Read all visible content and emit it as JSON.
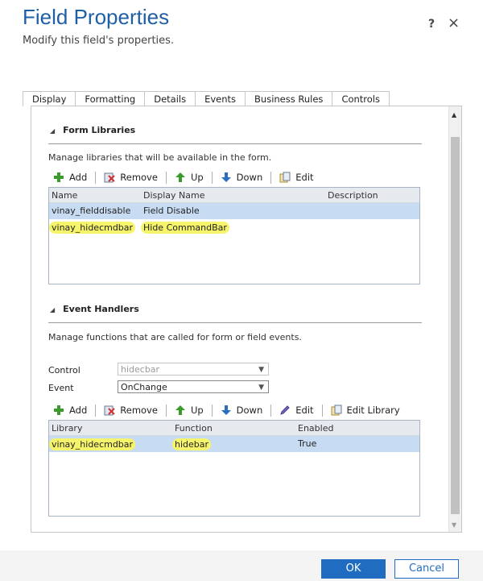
{
  "dialog": {
    "title": "Field Properties",
    "subtitle": "Modify this field's properties.",
    "help_glyph": "?",
    "close_glyph": "×"
  },
  "tabs": [
    {
      "label": "Display"
    },
    {
      "label": "Formatting"
    },
    {
      "label": "Details"
    },
    {
      "label": "Events",
      "active": true
    },
    {
      "label": "Business Rules"
    },
    {
      "label": "Controls"
    }
  ],
  "form_libraries": {
    "heading": "Form Libraries",
    "description": "Manage libraries that will be available in the form.",
    "toolbar": {
      "add": "Add",
      "remove": "Remove",
      "up": "Up",
      "down": "Down",
      "edit": "Edit"
    },
    "columns": {
      "name": "Name",
      "display_name": "Display Name",
      "description": "Description"
    },
    "rows": [
      {
        "name": "vinay_fielddisable",
        "display_name": "Field Disable",
        "description": ""
      },
      {
        "name": "vinay_hidecmdbar",
        "display_name": "Hide CommandBar",
        "description": ""
      }
    ]
  },
  "event_handlers": {
    "heading": "Event Handlers",
    "description": "Manage functions that are called for form or field events.",
    "control_label": "Control",
    "control_value": "hidecbar",
    "event_label": "Event",
    "event_value": "OnChange",
    "toolbar": {
      "add": "Add",
      "remove": "Remove",
      "up": "Up",
      "down": "Down",
      "edit": "Edit",
      "edit_library": "Edit Library"
    },
    "columns": {
      "library": "Library",
      "function": "Function",
      "enabled": "Enabled"
    },
    "rows": [
      {
        "library": "vinay_hidecmdbar",
        "function": "hidebar",
        "enabled": "True"
      }
    ]
  },
  "footer": {
    "ok": "OK",
    "cancel": "Cancel"
  },
  "colors": {
    "accent": "#1f6cc1",
    "title": "#1f5fa6",
    "highlight": "#f6f46a",
    "selected_row": "#c7dcf3"
  }
}
